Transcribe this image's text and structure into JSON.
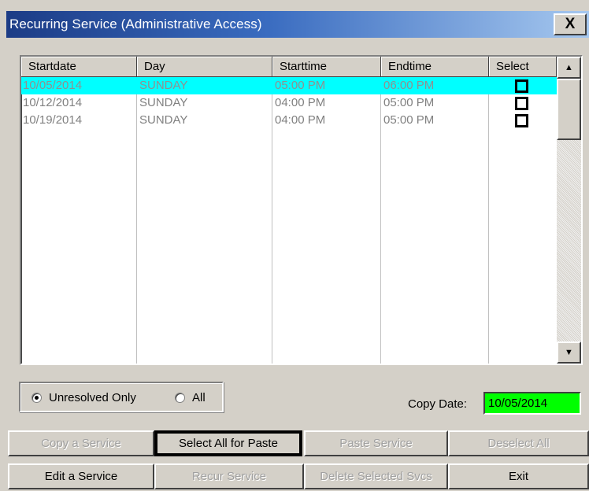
{
  "window": {
    "title": "Recurring Service (Administrative Access)",
    "close_label": "X"
  },
  "list": {
    "columns": [
      "Startdate",
      "Day",
      "Starttime",
      "Endtime",
      "Select"
    ],
    "rows": [
      {
        "startdate": "10/05/2014",
        "day": "SUNDAY",
        "starttime": "05:00 PM",
        "endtime": "06:00 PM",
        "selected": true,
        "checked": false
      },
      {
        "startdate": "10/12/2014",
        "day": "SUNDAY",
        "starttime": "04:00 PM",
        "endtime": "05:00 PM",
        "selected": false,
        "checked": false
      },
      {
        "startdate": "10/19/2014",
        "day": "SUNDAY",
        "starttime": "04:00 PM",
        "endtime": "05:00 PM",
        "selected": false,
        "checked": false
      }
    ],
    "highlight_color": "#00ffff"
  },
  "filter": {
    "unresolved_label": "Unresolved Only",
    "all_label": "All",
    "selected": "unresolved"
  },
  "copy": {
    "label": "Copy Date:",
    "value": "10/05/2014",
    "color": "#00ff00"
  },
  "buttons": {
    "copy_service": "Copy a Service",
    "select_all_paste": "Select All  for Paste",
    "paste_service": "Paste Service",
    "deselect_all": "Deselect All",
    "edit_service": "Edit a Service",
    "recur_service": "Recur Service",
    "delete_selected": "Delete Selected Svcs",
    "exit": "Exit"
  }
}
